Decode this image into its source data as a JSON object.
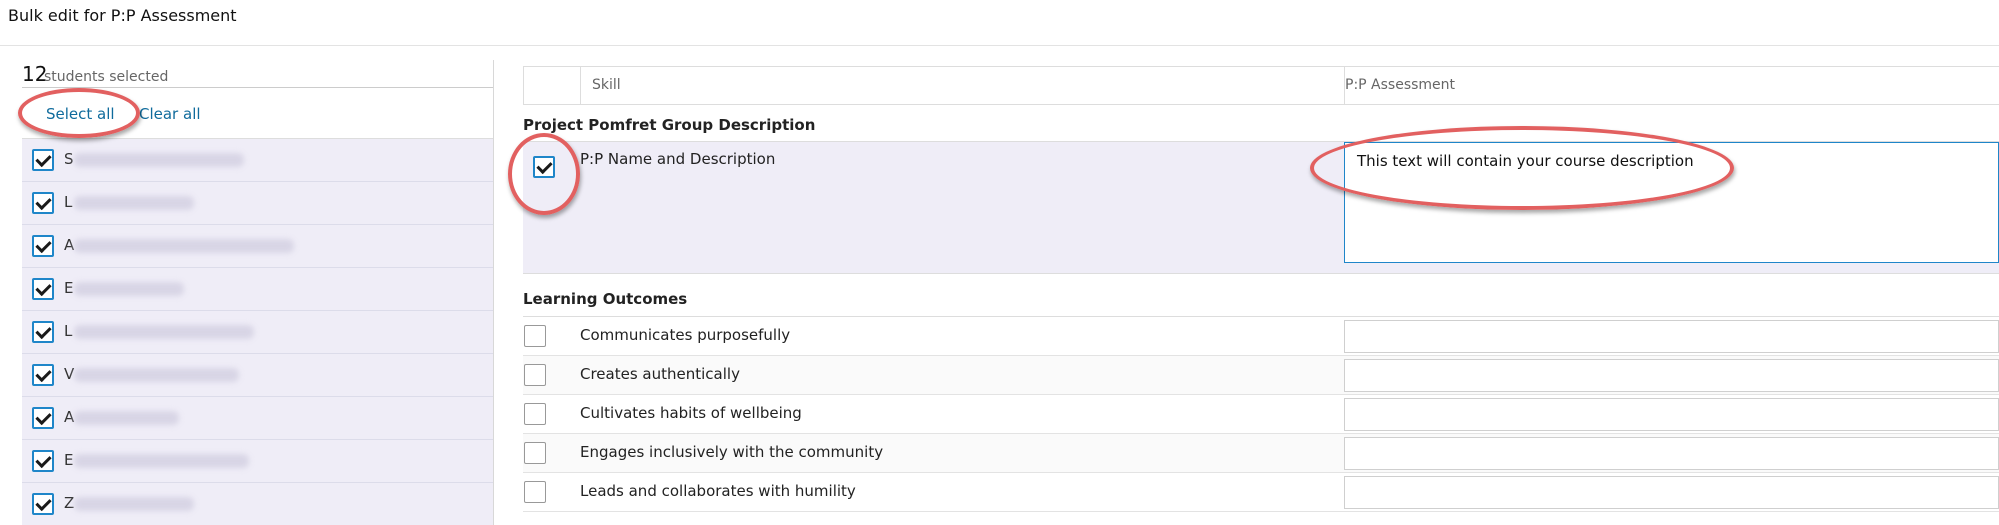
{
  "page": {
    "title": "Bulk edit for P:P Assessment"
  },
  "left": {
    "count": "12",
    "count_label": "students selected",
    "select_all": "Select all",
    "clear_all": "Clear all",
    "students": [
      {
        "initial": "S",
        "checked": true
      },
      {
        "initial": "L",
        "checked": true
      },
      {
        "initial": "A",
        "checked": true
      },
      {
        "initial": "E",
        "checked": true
      },
      {
        "initial": "L",
        "checked": true
      },
      {
        "initial": "V",
        "checked": true
      },
      {
        "initial": "A",
        "checked": true
      },
      {
        "initial": "E",
        "checked": true
      },
      {
        "initial": "Z",
        "checked": true
      }
    ]
  },
  "table": {
    "col_skill": "Skill",
    "col_assessment": "P:P Assessment",
    "group1": {
      "title": "Project Pomfret Group Description",
      "row": {
        "label": "P:P Name and Description",
        "value": "This text will contain your course description",
        "checked": true
      }
    },
    "group2": {
      "title": "Learning Outcomes",
      "rows": [
        {
          "label": "Communicates purposefully",
          "checked": false
        },
        {
          "label": "Creates authentically",
          "checked": false
        },
        {
          "label": "Cultivates habits of wellbeing",
          "checked": false
        },
        {
          "label": "Engages inclusively with the community",
          "checked": false
        },
        {
          "label": "Leads and collaborates with humility",
          "checked": false
        }
      ]
    }
  },
  "colors": {
    "accent": "#1f86c9",
    "link": "#0f6b9c",
    "highlight_row": "#efedf7",
    "annotation": "#e26060"
  }
}
